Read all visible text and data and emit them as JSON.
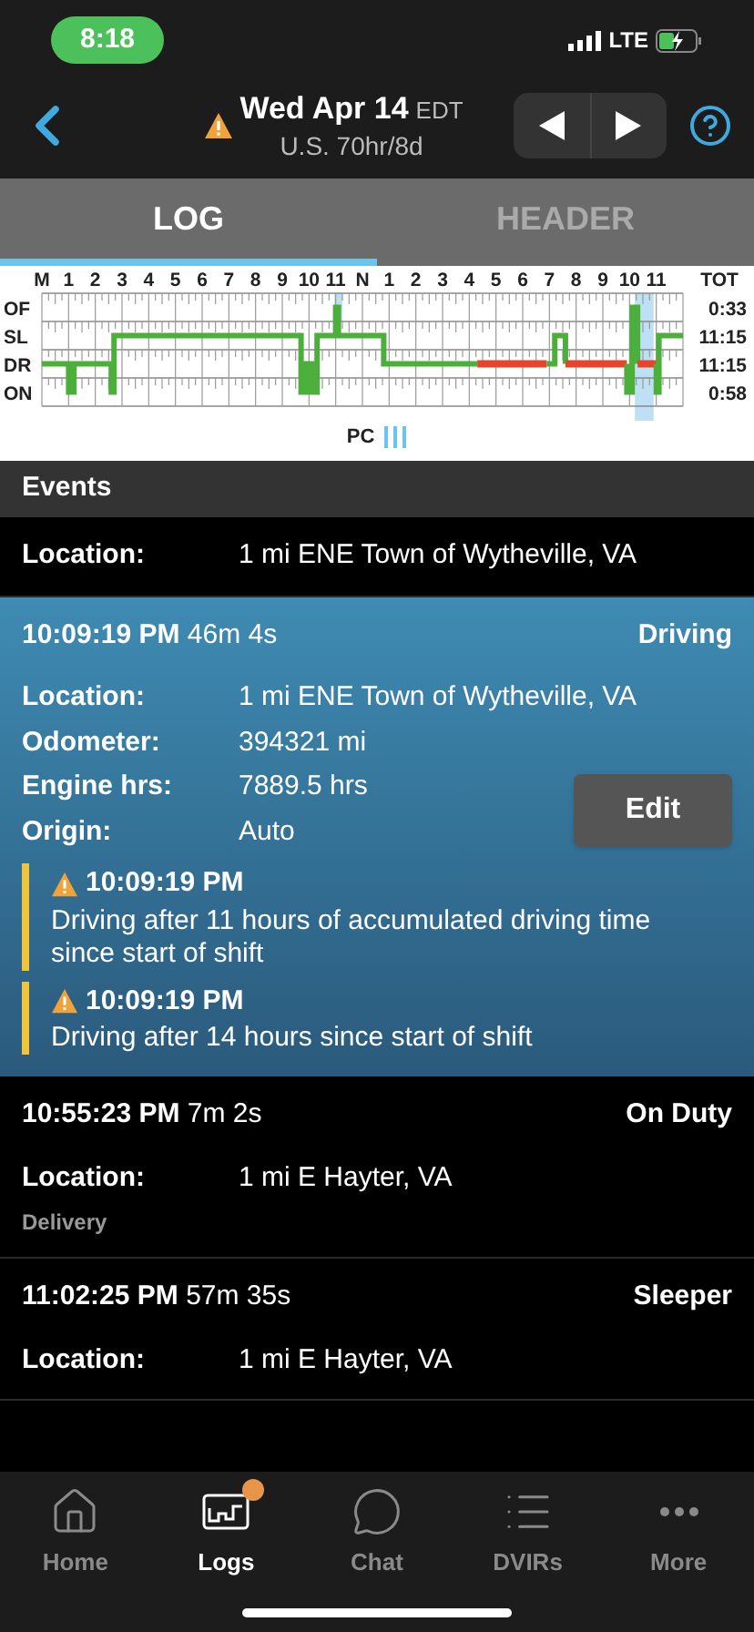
{
  "status_bar": {
    "time": "8:18",
    "network": "LTE"
  },
  "header": {
    "date": "Wed Apr 14",
    "timezone": "EDT",
    "ruleset": "U.S. 70hr/8d",
    "warning": true
  },
  "tabs": [
    {
      "label": "LOG",
      "selected": true
    },
    {
      "label": "HEADER",
      "selected": false
    }
  ],
  "log_grid": {
    "hours": [
      "M",
      "1",
      "2",
      "3",
      "4",
      "5",
      "6",
      "7",
      "8",
      "9",
      "10",
      "11",
      "N",
      "1",
      "2",
      "3",
      "4",
      "5",
      "6",
      "7",
      "8",
      "9",
      "10",
      "11"
    ],
    "total_heading": "TOT",
    "rows": [
      {
        "status": "OF",
        "total": "0:33"
      },
      {
        "status": "SL",
        "total": "11:15"
      },
      {
        "status": "DR",
        "total": "11:15"
      },
      {
        "status": "ON",
        "total": "0:58"
      }
    ],
    "pc_label": "PC"
  },
  "events_heading": "Events",
  "events": [
    {
      "selected": false,
      "fields": [
        {
          "label": "Location:",
          "value": "1 mi ENE Town of Wytheville, VA"
        }
      ]
    },
    {
      "selected": true,
      "time": "10:09:19 PM",
      "duration": "46m 4s",
      "status": "Driving",
      "fields": [
        {
          "label": "Location:",
          "value": "1 mi ENE Town of Wytheville, VA"
        },
        {
          "label": "Odometer:",
          "value": "394321 mi"
        },
        {
          "label": "Engine hrs:",
          "value": "7889.5 hrs"
        },
        {
          "label": "Origin:",
          "value": "Auto"
        }
      ],
      "edit": "Edit",
      "alerts": [
        {
          "time": "10:09:19 PM",
          "text": "Driving after 11 hours of accumulated driving time since start of shift"
        },
        {
          "time": "10:09:19 PM",
          "text": "Driving after 14 hours since start of shift"
        }
      ]
    },
    {
      "selected": false,
      "time": "10:55:23 PM",
      "duration": "7m 2s",
      "status": "On Duty",
      "fields": [
        {
          "label": "Location:",
          "value": "1 mi E Hayter, VA"
        }
      ],
      "note": "Delivery"
    },
    {
      "selected": false,
      "time": "11:02:25 PM",
      "duration": "57m 35s",
      "status": "Sleeper",
      "fields": [
        {
          "label": "Location:",
          "value": "1 mi E Hayter, VA"
        }
      ]
    }
  ],
  "nav": [
    {
      "label": "Home",
      "kind": "home",
      "selected": false,
      "badge": false
    },
    {
      "label": "Logs",
      "kind": "logs",
      "selected": true,
      "badge": true
    },
    {
      "label": "Chat",
      "kind": "chat",
      "selected": false,
      "badge": false
    },
    {
      "label": "DVIRs",
      "kind": "list",
      "selected": false,
      "badge": false
    },
    {
      "label": "More",
      "kind": "more",
      "selected": false,
      "badge": false
    }
  ]
}
